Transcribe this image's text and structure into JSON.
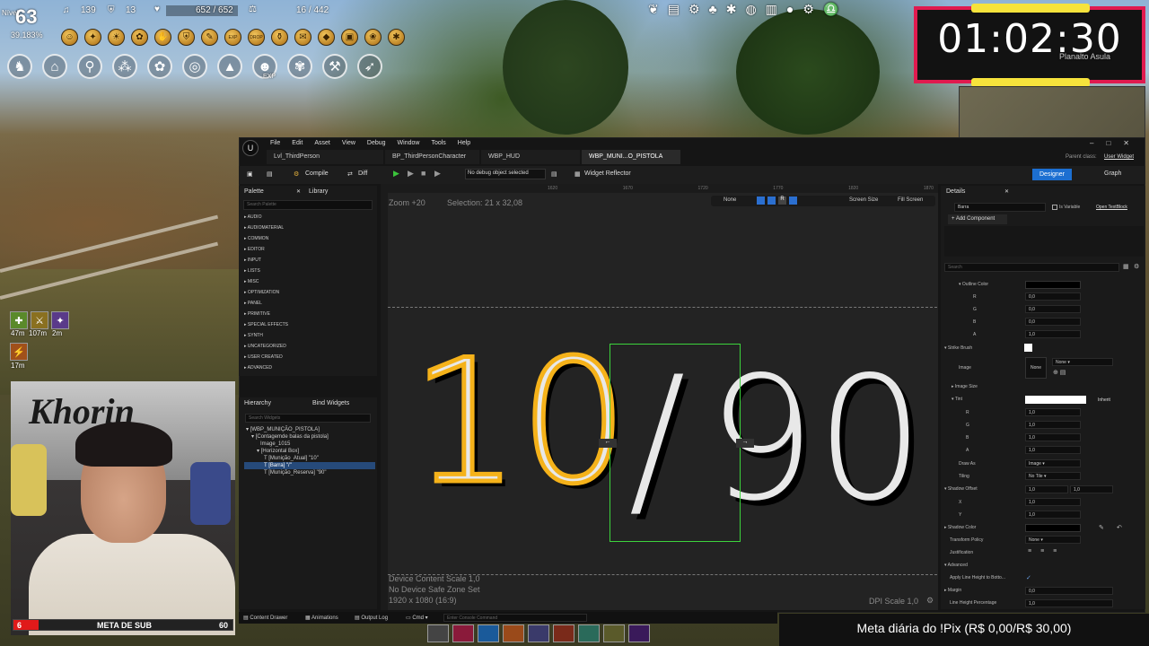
{
  "game_hud": {
    "level_label": "Nível",
    "level": "63",
    "level_percent": "39.183%",
    "stat_music": "139",
    "stat_shield": "13",
    "hp": "652 / 652",
    "weight": "16 / 442",
    "region": "Planalto Asula",
    "buff_timers": [
      "47m",
      "107m",
      "2m",
      "17m"
    ],
    "exp_labels": [
      "EXP",
      "DROP",
      "EXP"
    ]
  },
  "timer": {
    "display": "01:02:30"
  },
  "stream": {
    "sub_goal_label": "META DE SUB",
    "sub_current": "6",
    "sub_target": "60",
    "pix_goal": "Meta diária do !Pix (R$ 0,00/R$ 30,00)",
    "webcam_sign": "Khorin"
  },
  "ue": {
    "menu": [
      "File",
      "Edit",
      "Asset",
      "View",
      "Debug",
      "Window",
      "Tools",
      "Help"
    ],
    "tabs": [
      "Lvl_ThirdPerson",
      "BP_ThirdPersonCharacter",
      "WBP_HUD",
      "WBP_MUNI...O_PISTOLA"
    ],
    "parent_class_label": "Parent class:",
    "parent_class": "User Widget",
    "toolbar": {
      "compile": "Compile",
      "diff": "Diff",
      "debug_select": "No debug object selected",
      "widget_reflector": "Widget Reflector"
    },
    "mode_designer": "Designer",
    "mode_graph": "Graph",
    "palette": {
      "tab": "Palette",
      "library_tab": "Library",
      "search_placeholder": "Search Palette",
      "categories": [
        "AUDIO",
        "AUDIOMATERIAL",
        "COMMON",
        "EDITOR",
        "INPUT",
        "LISTS",
        "MISC",
        "OPTIMIZATION",
        "PANEL",
        "PRIMITIVE",
        "SPECIAL EFFECTS",
        "SYNTH",
        "UNCATEGORIZED",
        "USER CREATED",
        "ADVANCED"
      ]
    },
    "hierarchy": {
      "tab": "Hierarchy",
      "bind_tab": "Bind Widgets",
      "search_placeholder": "Search Widgets",
      "items": [
        "[WBP_MUNIÇÃO_PISTOLA]",
        "[Contagemde balas da pistola]",
        "Image_1015",
        "[Horizontal Box]",
        "[Munição_Atual] \"10\"",
        "[Barra] \"/\"",
        "[Munição_Reserva] \"90\""
      ]
    },
    "canvas": {
      "zoom": "Zoom +20",
      "selection": "Selection: 21 x 32,08",
      "ruler_ticks": [
        "1620",
        "1670",
        "1720",
        "1770",
        "1820",
        "1870"
      ],
      "none_label": "None",
      "screen_size": "Screen Size",
      "fill_screen": "Fill Screen",
      "ammo_current": "10",
      "slash": "/",
      "ammo_reserve": "90",
      "device_scale": "Device Content Scale 1,0",
      "safe_zone": "No Device Safe Zone Set",
      "resolution": "1920 x 1080 (16:9)",
      "dpi_scale": "DPI Scale 1,0"
    },
    "details": {
      "tab": "Details",
      "widget_name": "Barra",
      "is_variable": "Is Variable",
      "open_textblock": "Open TextBlock",
      "add_component": "Add Component",
      "search_placeholder": "Search",
      "outline_color": "Outline Color",
      "r": "R",
      "g": "G",
      "b": "B",
      "a": "A",
      "outline_r": "0,0",
      "outline_g": "0,0",
      "outline_b": "0,0",
      "outline_a": "1,0",
      "strike_brush": "Strike Brush",
      "image": "Image",
      "image_value": "None",
      "image_size": "Image Size",
      "tint": "Tint",
      "inherit": "Inherit",
      "tint_r": "1,0",
      "tint_g": "1,0",
      "tint_b": "1,0",
      "tint_a": "1,0",
      "draw_as": "Draw As",
      "draw_as_value": "Image",
      "tiling": "Tiling",
      "tiling_value": "No Tile",
      "shadow_offset": "Shadow Offset",
      "shadow_x": "1,0",
      "shadow_y": "1,0",
      "x": "X",
      "y": "Y",
      "shadow_color": "Shadow Color",
      "transform_policy": "Transform Policy",
      "transform_policy_value": "None",
      "justification": "Justification",
      "advanced": "Advanced",
      "apply_line_height": "Apply Line Height to Botto...",
      "margin": "Margin",
      "margin_value": "0,0",
      "line_height": "Line Height Percentage",
      "line_height_value": "1,0"
    },
    "bottom_bar": {
      "content_drawer": "Content Drawer",
      "animations": "Animations",
      "output_log": "Output Log",
      "cmd": "Cmd",
      "console_placeholder": "Enter Console Command"
    }
  },
  "colors": {
    "timer_border": "#e01a4f",
    "timer_accent": "#f6e33c",
    "outline_orange": "#f5b21a",
    "selection_green": "#3cd33c",
    "designer_blue": "#1c6fd1"
  }
}
